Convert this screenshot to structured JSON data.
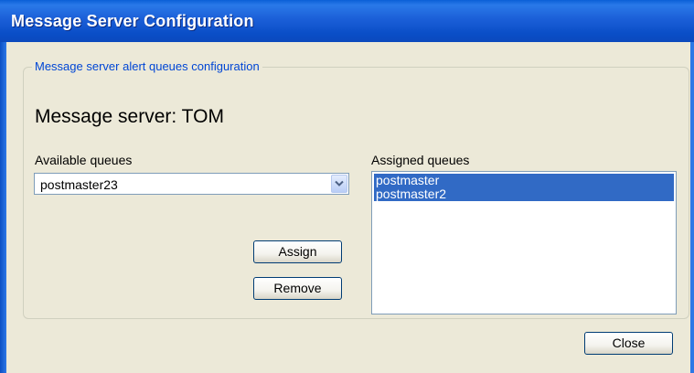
{
  "window": {
    "title": "Message Server Configuration"
  },
  "groupbox": {
    "legend": "Message server alert queues configuration"
  },
  "server": {
    "label": "Message server: TOM"
  },
  "available": {
    "label": "Available queues",
    "selected": "postmaster23"
  },
  "assigned": {
    "label": "Assigned queues",
    "items": [
      "postmaster",
      "postmaster2"
    ]
  },
  "buttons": {
    "assign": "Assign",
    "remove": "Remove",
    "close": "Close"
  },
  "icons": {
    "dropdown": "chevron-down-icon"
  },
  "colors": {
    "titlebar": "#0a4ec7",
    "selection": "#316ac5",
    "dialog_bg": "#ece9d8",
    "legend_text": "#0046d5"
  }
}
